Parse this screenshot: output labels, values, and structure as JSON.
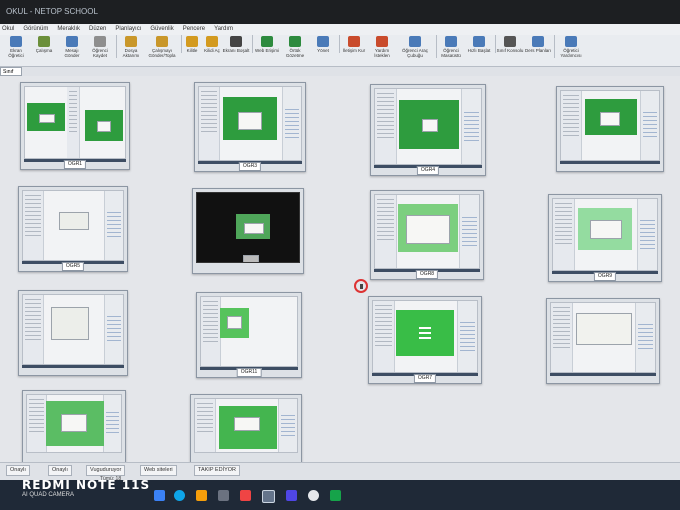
{
  "app": {
    "title": "NETOP SCHOOL",
    "title_prefix": "OKUL"
  },
  "menu": [
    "Okul",
    "Görünüm",
    "Meraklık",
    "Düzen",
    "Planlayıcı",
    "Güvenlik",
    "Pencere",
    "Yardım"
  ],
  "toolbar": [
    {
      "label": "Ekran Öğretici",
      "icon": "monitor-icon",
      "color": "#4a7ab8"
    },
    {
      "label": "Çalışma",
      "icon": "clipboard-icon",
      "color": "#6b8f3a"
    },
    {
      "label": "Mesajı Gönder",
      "icon": "message-icon",
      "color": "#4a7ab8"
    },
    {
      "label": "Öğrenci Kaydet",
      "icon": "user-icon",
      "color": "#8e8e8e"
    },
    {
      "label": "Dosya Aktarımı",
      "icon": "folder-icon",
      "color": "#c9972a"
    },
    {
      "label": "Çalışmayı Gönder/Topla",
      "icon": "send-icon",
      "color": "#c9972a"
    },
    {
      "label": "Kilitle",
      "icon": "lock-icon",
      "color": "#d39a1f"
    },
    {
      "label": "Kilidi Aç",
      "icon": "unlock-icon",
      "color": "#d39a1f"
    },
    {
      "label": "Ekranı Boşalt",
      "icon": "blank-screen-icon",
      "color": "#444"
    },
    {
      "label": "Web Erişimi",
      "icon": "web-icon",
      "color": "#2d8a3e"
    },
    {
      "label": "Örtük Gözetme",
      "icon": "globe-icon",
      "color": "#2d8a3e"
    },
    {
      "label": "Yönet",
      "icon": "manage-icon",
      "color": "#4a7ab8"
    },
    {
      "label": "İletişim Kur",
      "icon": "chat-icon",
      "color": "#c94b2c"
    },
    {
      "label": "Yardım İsteklen",
      "icon": "help-icon",
      "color": "#c94b2c"
    },
    {
      "label": "Öğrenci Araç Çubuğu",
      "icon": "toolbar-icon",
      "color": "#4a7ab8"
    },
    {
      "label": "Öğrenci Masaüstü",
      "icon": "desktop-icon",
      "color": "#4a7ab8"
    },
    {
      "label": "Hızlı Başlat",
      "icon": "run-icon",
      "color": "#4a7ab8"
    },
    {
      "label": "Sınıf Konsolu",
      "icon": "console-icon",
      "color": "#555"
    },
    {
      "label": "Ders Planları",
      "icon": "puzzle-icon",
      "color": "#4a7ab8"
    },
    {
      "label": "Öğretici Yardımcısı",
      "icon": "assistant-icon",
      "color": "#4a7ab8"
    }
  ],
  "tabs": [
    {
      "label": "Sınıf"
    }
  ],
  "thumbnails": [
    {
      "caption": "OGR1"
    },
    {
      "caption": "OGR3"
    },
    {
      "caption": "OGR4"
    },
    {
      "caption": ""
    },
    {
      "caption": "OGR5"
    },
    {
      "caption": ""
    },
    {
      "caption": "OGR8"
    },
    {
      "caption": "OGR9"
    },
    {
      "caption": ""
    },
    {
      "caption": "OGR11"
    },
    {
      "caption": "OGR7"
    },
    {
      "caption": ""
    },
    {
      "caption": ""
    },
    {
      "caption": ""
    }
  ],
  "statusbar": {
    "items": [
      "Onaylı",
      "Onaylı",
      "Vuguduruyor",
      "Web siteleri",
      "TAKIP EDİYOR"
    ],
    "bottom_text": "Tümü: 18"
  },
  "watermark": {
    "model": "REDMI NOTE 11S",
    "sub": "AI QUAD CAMERA"
  }
}
